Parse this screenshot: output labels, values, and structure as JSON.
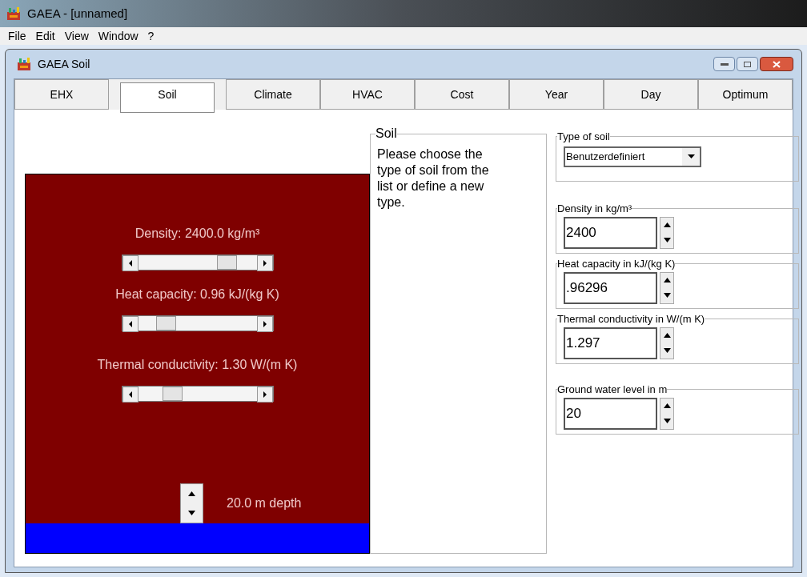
{
  "app_window": {
    "title": "GAEA - [unnamed]"
  },
  "menu": [
    "File",
    "Edit",
    "View",
    "Window",
    "?"
  ],
  "child_window": {
    "title": "GAEA Soil"
  },
  "tabs": [
    {
      "label": "EHX",
      "selected": false
    },
    {
      "label": "Soil",
      "selected": true
    },
    {
      "label": "Climate",
      "selected": false
    },
    {
      "label": "HVAC",
      "selected": false
    },
    {
      "label": "Cost",
      "selected": false
    },
    {
      "label": "Year",
      "selected": false
    },
    {
      "label": "Day",
      "selected": false
    },
    {
      "label": "Optimum",
      "selected": false
    }
  ],
  "soil_view": {
    "sliders": [
      {
        "label": "Density: 2400.0 kg/m³"
      },
      {
        "label": "Heat capacity: 0.96 kJ/(kg K)"
      },
      {
        "label": "Thermal conductivity: 1.30 W/(m K)"
      }
    ],
    "depth_label": "20.0 m depth"
  },
  "info": {
    "title": "Soil",
    "text": "Please choose the type of soil from the list or define a new type."
  },
  "type_of_soil": {
    "title": "Type of soil",
    "value": "Benutzerdefiniert"
  },
  "fields": [
    {
      "title": "Density in kg/m³",
      "value": "2400"
    },
    {
      "title": "Heat capacity in kJ/(kg K)",
      "value": ".96296"
    },
    {
      "title": "Thermal conductivity in W/(m K)",
      "value": "1.297"
    },
    {
      "title": "Ground water level in m",
      "value": "20"
    }
  ]
}
